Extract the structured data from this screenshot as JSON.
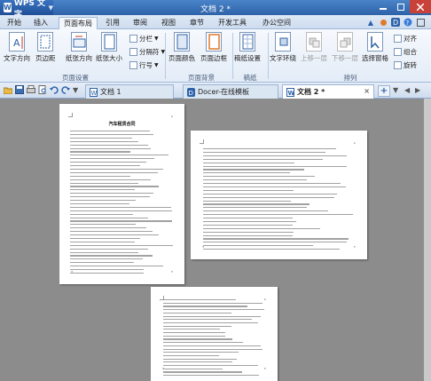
{
  "app": {
    "name": "WPS 文字",
    "window_title": "文档 2 *",
    "accent": "#2d62a8"
  },
  "menu": {
    "tabs": [
      {
        "label": "开始",
        "active": false
      },
      {
        "label": "插入",
        "active": false
      },
      {
        "label": "页面布局",
        "active": true
      },
      {
        "label": "引用",
        "active": false
      },
      {
        "label": "审阅",
        "active": false
      },
      {
        "label": "视图",
        "active": false
      },
      {
        "label": "章节",
        "active": false
      },
      {
        "label": "开发工具",
        "active": false
      },
      {
        "label": "办公空间",
        "active": false
      }
    ]
  },
  "ribbon": {
    "text_direction": "文字方向",
    "margins": "页边距",
    "orientation": "纸张方向",
    "size": "纸张大小",
    "columns": "分栏",
    "breaks": "分隔符",
    "line_numbers": "行号",
    "page_color": "页面颜色",
    "page_border": "页面边框",
    "manuscript": "稿纸设置",
    "wrap_text": "文字环绕",
    "bring_forward": "上移一层",
    "send_backward": "下移一层",
    "selection_pane": "选择窗格",
    "align": "对齐",
    "group": "组合",
    "rotate": "旋转",
    "group_page_setup": "页面设置",
    "group_page_background": "页面背景",
    "group_manuscript": "稿纸",
    "group_arrange": "排列"
  },
  "doc_tabs": [
    {
      "label": "文档 1",
      "active": false
    },
    {
      "label": "Docer-在线模板",
      "active": false
    },
    {
      "label": "文档 2 *",
      "active": true
    }
  ],
  "document": {
    "page1_title": "汽车租赁合同"
  }
}
